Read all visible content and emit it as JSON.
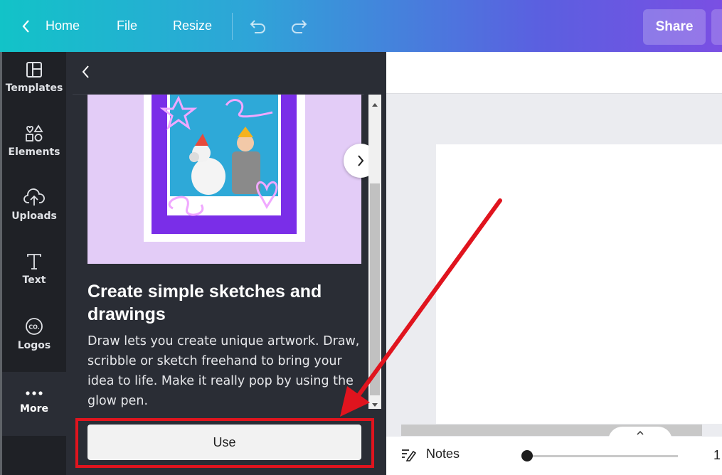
{
  "topbar": {
    "home": "Home",
    "file": "File",
    "resize": "Resize",
    "share": "Share"
  },
  "rail": {
    "items": [
      {
        "label": "Templates",
        "icon": "templates-icon"
      },
      {
        "label": "Elements",
        "icon": "elements-icon"
      },
      {
        "label": "Uploads",
        "icon": "uploads-icon"
      },
      {
        "label": "Text",
        "icon": "text-icon"
      },
      {
        "label": "Logos",
        "icon": "logos-icon"
      },
      {
        "label": "More",
        "icon": "more-dots-icon"
      }
    ]
  },
  "panel": {
    "title": "Create simple sketches and drawings",
    "description": "Draw lets you create unique artwork. Draw, scribble or sketch freehand to bring your idea to life. Make it really pop by using the glow pen.",
    "use_label": "Use",
    "logo_text": "CO."
  },
  "footer": {
    "notes": "Notes",
    "zoom": "1"
  },
  "colors": {
    "accent_red": "#e0141e",
    "panel_bg": "#2a2d35",
    "hero_bg": "#e3ccf7"
  }
}
